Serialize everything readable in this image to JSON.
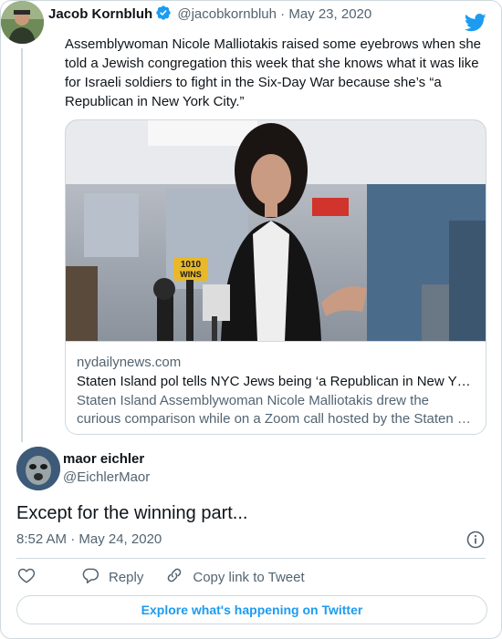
{
  "parent_tweet": {
    "author_name": "Jacob Kornbluh",
    "handle": "@jacobkornbluh",
    "separator": "·",
    "date": "May 23, 2020",
    "text": "Assemblywoman Nicole Malliotakis raised some eyebrows when she told a Jewish congregation this week that she knows what it was like for Israeli soldiers to fight in the Six-Day War because she’s “a Republican in New York City.”",
    "verified_icon": "verified-badge-icon",
    "platform_icon": "twitter-bird-icon",
    "card": {
      "domain": "nydailynews.com",
      "title": "Staten Island pol tells NYC Jews being ‘a Republican in New Y…",
      "description": "Staten Island Assemblywoman Nicole Malliotakis drew the curious comparison while on a Zoom call hosted by the Staten …",
      "image_mic_label_top": "1010",
      "image_mic_label_bottom": "WINS"
    }
  },
  "reply_tweet": {
    "author_name": "maor eichler",
    "handle": "@EichlerMaor",
    "text": "Except for the winning part...",
    "timestamp": "8:52 AM · May 24, 2020"
  },
  "actions": {
    "reply_label": "Reply",
    "copy_link_label": "Copy link to Tweet"
  },
  "explore_button_label": "Explore what's happening on Twitter",
  "colors": {
    "accent": "#1d9bf0",
    "secondary_text": "#536471",
    "border": "#cfd9de"
  }
}
